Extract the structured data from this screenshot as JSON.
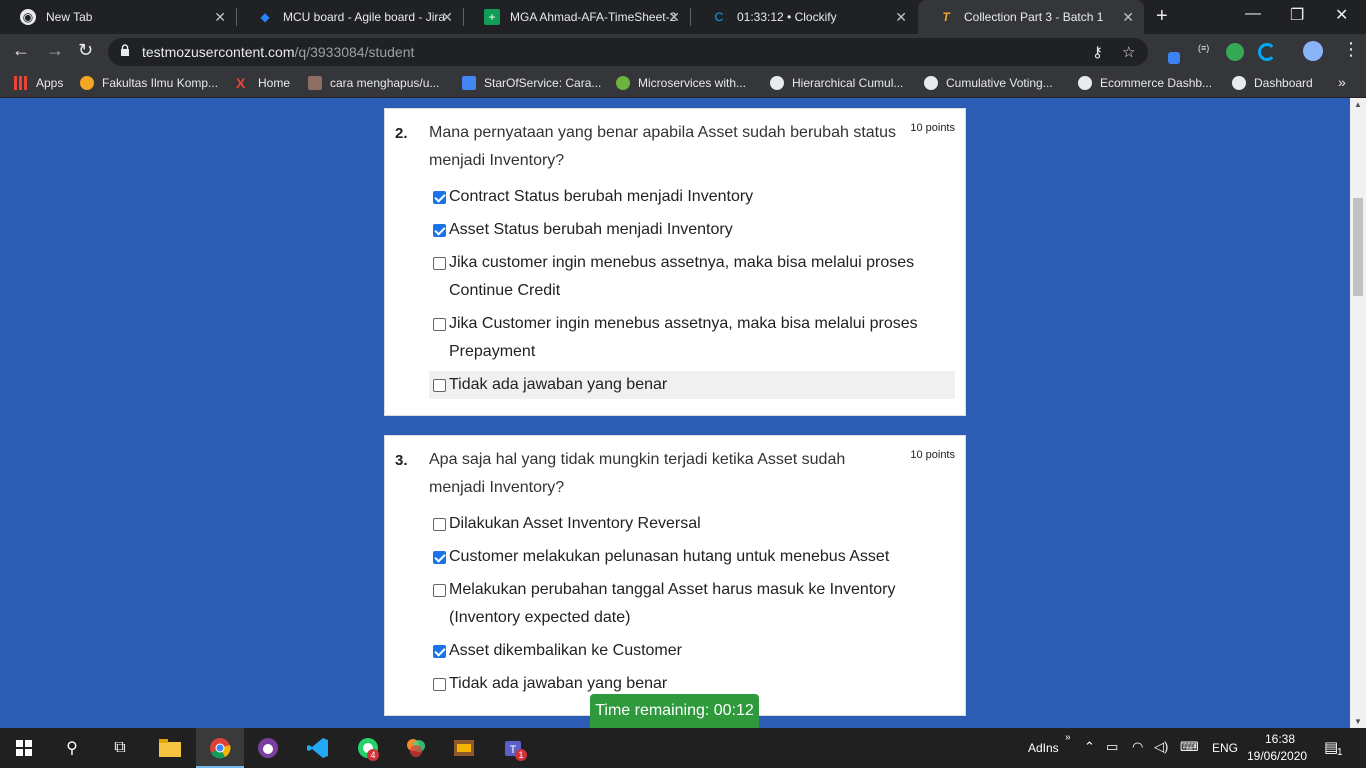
{
  "browser": {
    "tabs": [
      {
        "title": "New Tab",
        "icon": "chrome-icon",
        "active": false
      },
      {
        "title": "MCU board - Agile board - Jira",
        "icon": "jira-icon",
        "active": false
      },
      {
        "title": "MGA Ahmad-AFA-TimeSheet-2",
        "icon": "sheets-icon",
        "active": false
      },
      {
        "title": "01:33:12 • Clockify",
        "icon": "clockify-icon",
        "active": false
      },
      {
        "title": "Collection Part 3 - Batch 1",
        "icon": "testmoz-icon",
        "active": true
      }
    ],
    "url_host": "testmozusercontent.com",
    "url_path": "/q/3933084/student",
    "bookmarks": [
      {
        "label": "Apps",
        "icon": "apps-grid-icon"
      },
      {
        "label": "Fakultas Ilmu Komp...",
        "icon": "uni-icon"
      },
      {
        "label": "Home",
        "icon": "x-icon"
      },
      {
        "label": "cara menghapus/u...",
        "icon": "image-icon"
      },
      {
        "label": "StarOfService: Cara...",
        "icon": "star-service-icon"
      },
      {
        "label": "Microservices with...",
        "icon": "spring-icon"
      },
      {
        "label": "Hierarchical Cumul...",
        "icon": "github-icon"
      },
      {
        "label": "Cumulative Voting...",
        "icon": "github-icon"
      },
      {
        "label": "Ecommerce Dashb...",
        "icon": "github-icon"
      },
      {
        "label": "Dashboard",
        "icon": "wordpress-icon"
      }
    ],
    "more_bookmarks": "»"
  },
  "quiz": {
    "questions": [
      {
        "number": "2.",
        "text": "Mana pernyataan yang benar apabila Asset sudah berubah status menjadi Inventory?",
        "points": "10 points",
        "options": [
          {
            "label": "Contract Status berubah menjadi Inventory",
            "checked": true
          },
          {
            "label": "Asset Status berubah menjadi Inventory",
            "checked": true
          },
          {
            "label": "Jika customer ingin menebus assetnya, maka bisa melalui proses Continue Credit",
            "checked": false
          },
          {
            "label": "Jika Customer ingin menebus assetnya, maka bisa melalui proses Prepayment",
            "checked": false
          },
          {
            "label": "Tidak ada jawaban yang benar",
            "checked": false
          }
        ]
      },
      {
        "number": "3.",
        "text": "Apa saja hal yang tidak mungkin terjadi ketika Asset sudah menjadi Inventory?",
        "points": "10 points",
        "options": [
          {
            "label": "Dilakukan Asset Inventory Reversal",
            "checked": false
          },
          {
            "label": "Customer melakukan pelunasan hutang untuk menebus Asset",
            "checked": true
          },
          {
            "label": "Melakukan perubahan tanggal Asset harus masuk ke Inventory (Inventory expected date)",
            "checked": false
          },
          {
            "label": "Asset dikembalikan ke Customer",
            "checked": true
          },
          {
            "label": "Tidak ada jawaban yang benar",
            "checked": false
          }
        ]
      }
    ],
    "timer": "Time remaining: 00:12"
  },
  "taskbar": {
    "tray_label": "AdIns",
    "language": "ENG",
    "time": "16:38",
    "date": "19/06/2020",
    "whatsapp_badge": "4",
    "teams_badge": "1",
    "notification_count": "1"
  },
  "colors": {
    "page_bg": "#2d5cb5",
    "timer_bg": "#2e9a3c",
    "checkbox_checked": "#1a73e8"
  }
}
